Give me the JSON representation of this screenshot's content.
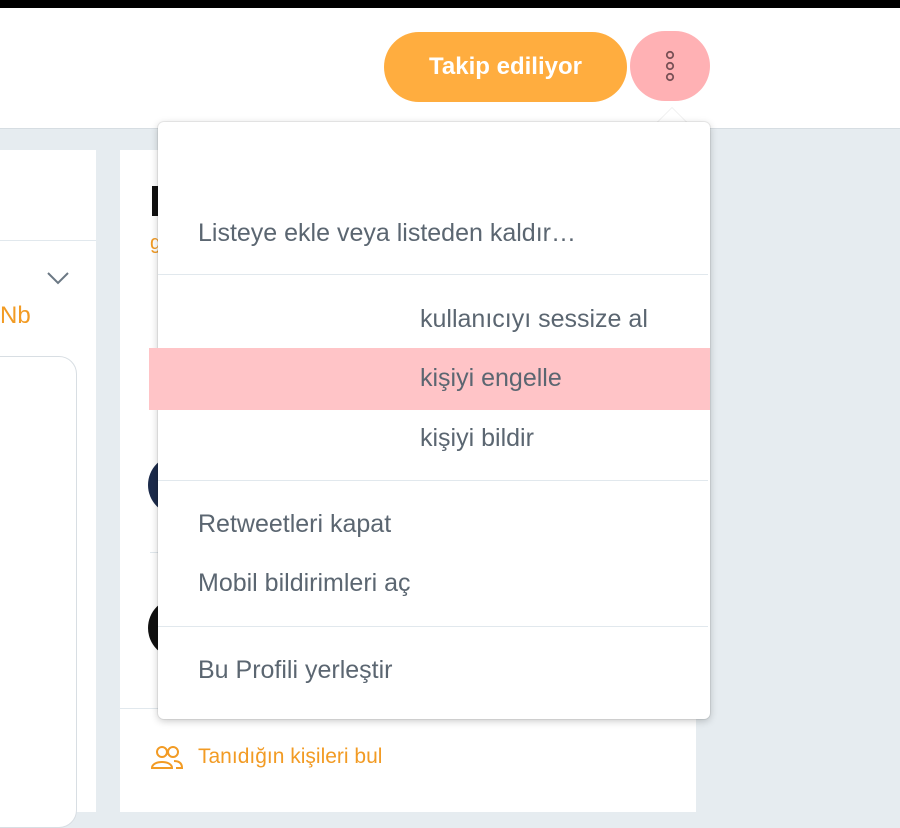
{
  "header": {
    "follow_button_label": "Takip ediliyor",
    "more_button_icon": "vertical-ellipsis-icon"
  },
  "left_panel": {
    "handle_fragment": "Nb",
    "chevron_icon": "chevron-down-icon"
  },
  "middle_panel": {
    "subtitle_fragment": "g",
    "find_people": {
      "icon": "people-icon",
      "label": "Tanıdığın kişileri bul"
    }
  },
  "dropdown": {
    "items": [
      {
        "label": "Listeye ekle veya listeden kaldır…"
      },
      {
        "label": "kullanıcıyı sessize al"
      },
      {
        "label": "kişiyi engelle",
        "highlighted": true
      },
      {
        "label": "kişiyi bildir"
      },
      {
        "label": "Retweetleri kapat"
      },
      {
        "label": "Mobil bildirimleri aç"
      },
      {
        "label": "Bu Profili yerleştir"
      }
    ]
  },
  "colors": {
    "accent": "#ffad3f",
    "highlight": "#ffc4c7",
    "more_button": "#ffb1b4",
    "link": "#f29b24",
    "menu_text": "#5b6671"
  }
}
